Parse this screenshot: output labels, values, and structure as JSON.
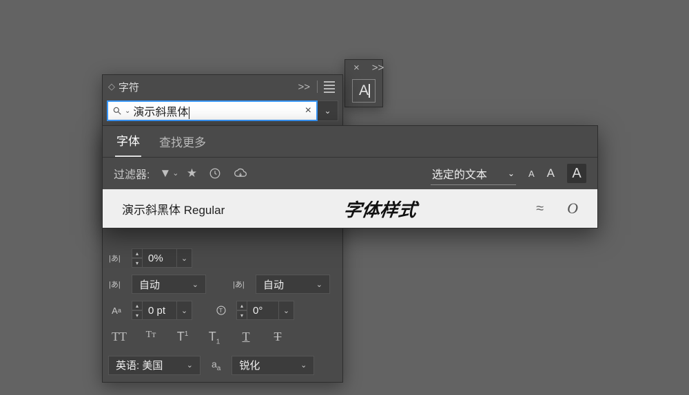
{
  "panel": {
    "title": "字符",
    "expand_label": ">>",
    "search": {
      "value": "演示斜黑体",
      "clear_icon": "×"
    }
  },
  "flyout": {
    "tabs": {
      "fonts": "字体",
      "find_more": "查找更多"
    },
    "filter_label": "过滤器:",
    "selected_text_label": "选定的文本",
    "size_glyph": "A",
    "font_row": {
      "name": "演示斜黑体 Regular",
      "preview": "字体样式",
      "similar": "≈",
      "opentype": "O"
    }
  },
  "controls": {
    "tracking": "0%",
    "kerning_left": "自动",
    "kerning_right": "自动",
    "baseline_shift": "0 pt",
    "rotate": "0°",
    "language": "英语: 美国",
    "antialias": "锐化"
  },
  "ot_glyphs": {
    "caps": "TT",
    "smallcaps": "Tᴛ",
    "sup": "T",
    "sup_mark": "1",
    "sub_mark": "1",
    "underline": "T",
    "strike": "T"
  },
  "mini": {
    "close": "×",
    "expand": ">>",
    "glyph": "A"
  }
}
